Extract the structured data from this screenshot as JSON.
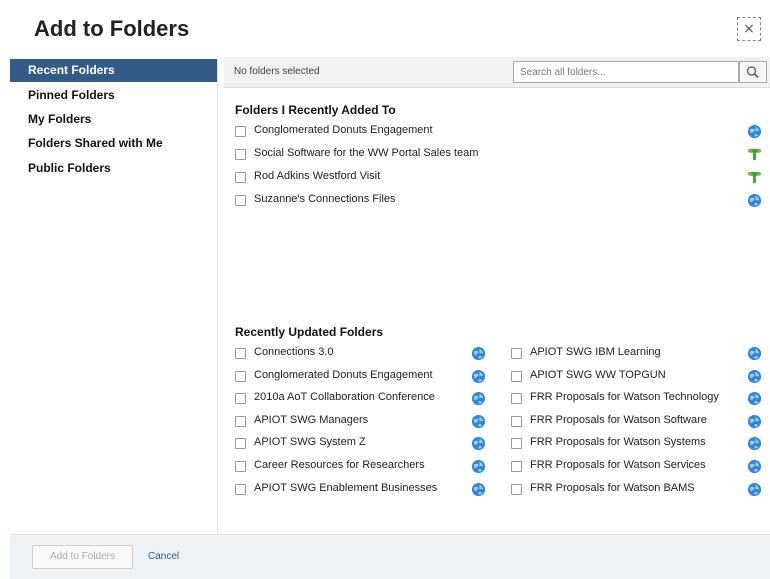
{
  "dialog": {
    "title": "Add to Folders",
    "close_glyph": "×"
  },
  "sidebar": {
    "items": [
      {
        "label": "Recent Folders",
        "active": true
      },
      {
        "label": "Pinned Folders",
        "active": false
      },
      {
        "label": "My Folders",
        "active": false
      },
      {
        "label": "Folders Shared with Me",
        "active": false
      },
      {
        "label": "Public Folders",
        "active": false
      }
    ]
  },
  "main": {
    "selection_status": "No folders selected",
    "search": {
      "placeholder": "Search all folders..."
    },
    "recently_added": {
      "heading": "Folders I Recently Added To",
      "items": [
        {
          "label": "Conglomerated Donuts Engagement",
          "icon": "globe-icon"
        },
        {
          "label": "Social Software for the WW Portal Sales team",
          "icon": "shared-folder-icon"
        },
        {
          "label": "Rod Adkins Westford Visit",
          "icon": "shared-folder-icon"
        },
        {
          "label": "Suzanne's Connections Files",
          "icon": "globe-icon"
        }
      ]
    },
    "recently_updated": {
      "heading": "Recently Updated Folders",
      "left": [
        {
          "label": "Connections 3.0",
          "icon": "globe-icon"
        },
        {
          "label": "Conglomerated Donuts Engagement",
          "icon": "globe-icon"
        },
        {
          "label": "2010a AoT Collaboration Conference",
          "icon": "globe-icon"
        },
        {
          "label": "APIOT SWG Managers",
          "icon": "globe-icon"
        },
        {
          "label": "APIOT SWG System Z",
          "icon": "globe-icon"
        },
        {
          "label": "Career Resources for Researchers",
          "icon": "globe-icon"
        },
        {
          "label": "APIOT SWG Enablement Businesses",
          "icon": "globe-icon"
        }
      ],
      "right": [
        {
          "label": "APIOT SWG IBM Learning",
          "icon": "globe-icon"
        },
        {
          "label": "APIOT SWG WW TOPGUN",
          "icon": "globe-icon"
        },
        {
          "label": "FRR Proposals for Watson Technology",
          "icon": "globe-icon"
        },
        {
          "label": "FRR Proposals for Watson Software",
          "icon": "globe-icon"
        },
        {
          "label": "FRR Proposals for Watson Systems",
          "icon": "globe-icon"
        },
        {
          "label": "FRR Proposals for Watson Services",
          "icon": "globe-icon"
        },
        {
          "label": "FRR Proposals for Watson BAMS",
          "icon": "globe-icon"
        }
      ]
    }
  },
  "footer": {
    "add_label": "Add to Folders",
    "cancel_label": "Cancel"
  },
  "colors": {
    "accent": "#335b85",
    "globe": "#2f86d8",
    "shared": "#4aa12c",
    "link": "#2a58a6"
  }
}
